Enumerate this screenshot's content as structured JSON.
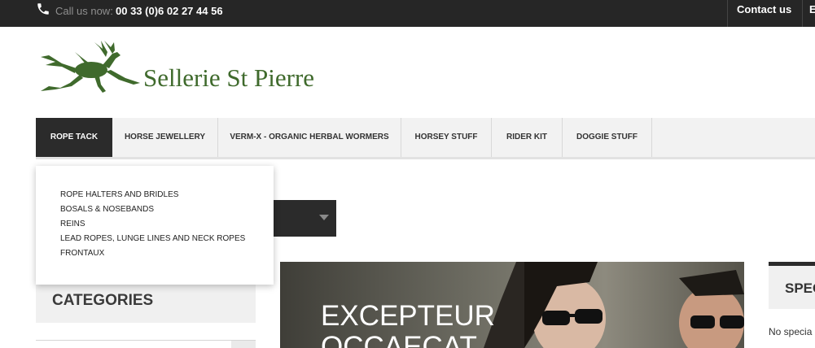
{
  "topbar": {
    "call_label": "Call us now:",
    "phone": "00 33 (0)6 02 27 44 56",
    "contact": "Contact us",
    "truncated_link": "E"
  },
  "brand": {
    "name": "Sellerie St Pierre",
    "color": "#3f6a2c"
  },
  "nav": {
    "items": [
      {
        "label": "ROPE TACK"
      },
      {
        "label": "HORSE JEWELLERY"
      },
      {
        "label": "VERM-X - ORGANIC HERBAL WORMERS"
      },
      {
        "label": "HORSEY STUFF"
      },
      {
        "label": "RIDER KIT"
      },
      {
        "label": "DOGGIE STUFF"
      }
    ]
  },
  "dropdown": {
    "items": [
      "ROPE HALTERS AND BRIDLES",
      "BOSALS & NOSEBANDS",
      "REINS",
      "LEAD ROPES, LUNGE LINES AND NECK ROPES",
      "FRONTAUX"
    ]
  },
  "sidebar": {
    "categories_title": "CATEGORIES"
  },
  "banner": {
    "line1": "EXCEPTEUR",
    "line2": "OCCAECAT"
  },
  "specials": {
    "title": "SPEC",
    "empty_text": "No specia"
  },
  "colors": {
    "dark": "#262626",
    "accent_green": "#3f6a2c",
    "nav_bg": "#f2f2f2"
  }
}
